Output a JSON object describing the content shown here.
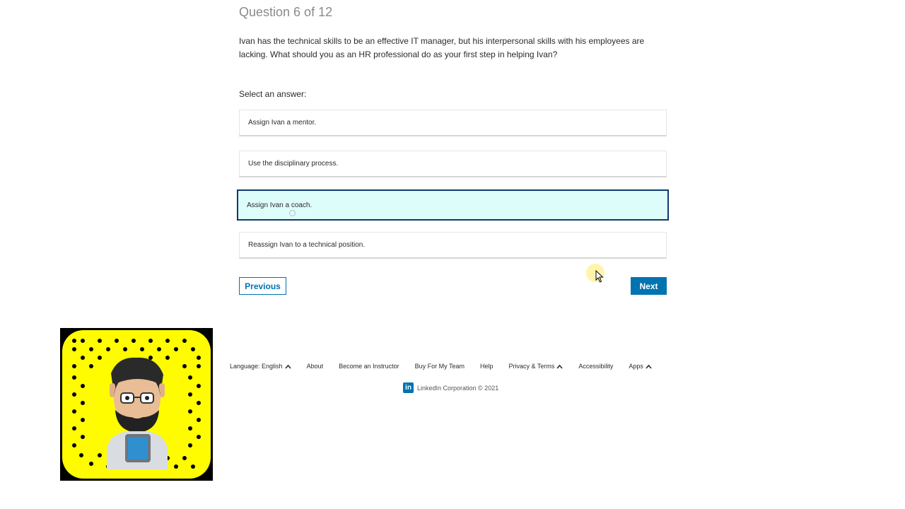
{
  "quiz": {
    "question_number": "Question 6 of 12",
    "question_text": "Ivan has the technical skills to be an effective IT manager, but his interpersonal skills with his employees are lacking. What should you as an HR professional do as your first step in helping Ivan?",
    "prompt": "Select an answer:",
    "answers": [
      {
        "label": "Assign Ivan a mentor.",
        "selected": false
      },
      {
        "label": "Use the disciplinary process.",
        "selected": false
      },
      {
        "label": "Assign Ivan a coach.",
        "selected": true
      },
      {
        "label": "Reassign Ivan to a technical position.",
        "selected": false
      }
    ],
    "previous_label": "Previous",
    "next_label": "Next"
  },
  "footer": {
    "links": [
      {
        "label": "Language: English",
        "caret": true
      },
      {
        "label": "About",
        "caret": false
      },
      {
        "label": "Become an Instructor",
        "caret": false
      },
      {
        "label": "Buy For My Team",
        "caret": false
      },
      {
        "label": "Help",
        "caret": false
      },
      {
        "label": "Privacy & Terms",
        "caret": true
      },
      {
        "label": "Accessibility",
        "caret": false
      },
      {
        "label": "Apps",
        "caret": true
      }
    ],
    "logo_letters": "in",
    "copyright": "LinkedIn Corporation © 2021"
  },
  "colors": {
    "accent": "#0073b1",
    "selected_bg": "#ddfdfb",
    "selected_border": "#0f3a6b",
    "snapcode_yellow": "#fffc00"
  },
  "icons": {
    "cursor": "pointer-cursor-icon",
    "caret": "chevron-up-icon",
    "logo": "linkedin-logo-icon",
    "snapcode": "snapcode-icon"
  }
}
